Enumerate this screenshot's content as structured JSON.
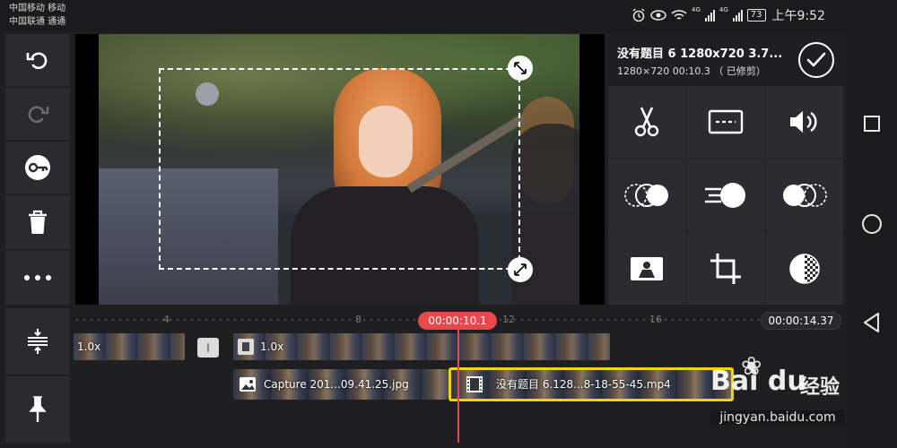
{
  "status_bar": {
    "carrier_1": "中国移动 移动",
    "carrier_2": "中国联通 通通",
    "net_4g": "4G",
    "net_4g_alt": "4G",
    "battery": "73",
    "time": "上午9:52",
    "icons": [
      "alarm-icon",
      "eye-icon",
      "wifi-icon",
      "signal-icon",
      "signal-icon",
      "battery-icon"
    ]
  },
  "toolbar": {
    "items": [
      "undo-icon",
      "redo-icon",
      "keyframe-icon",
      "trash-icon",
      "more-icon"
    ]
  },
  "preview": {
    "clip_title": "没有题目 6 1280x720 3.7...",
    "clip_meta": "1280×720  00:10.3 （ 已修剪）"
  },
  "edit_tools": [
    "scissors-icon",
    "subtitle-icon",
    "volume-icon",
    "blend-icon",
    "speed-icon",
    "reverse-icon",
    "chroma-icon",
    "crop-icon",
    "filter-icon"
  ],
  "timeline": {
    "ticks": [
      "4",
      "8",
      "12",
      "16"
    ],
    "current_time": "00:00:10.1",
    "total_time": "00:00:14.37",
    "clip_a_speed": "1.0x",
    "clip_b_speed": "1.0x",
    "layer_1_label": "Capture 201...09.41.25.jpg",
    "layer_2_label": "没有题目 6.128...8-18-55-45.mp4"
  },
  "watermark": {
    "logo": "Bai du",
    "logo_cn": "经验",
    "url": "jingyan.baidu.com"
  },
  "colors": {
    "accent_red": "#e8474c",
    "selected_yellow": "#f2d40a",
    "panel": "#2b2b2f"
  }
}
